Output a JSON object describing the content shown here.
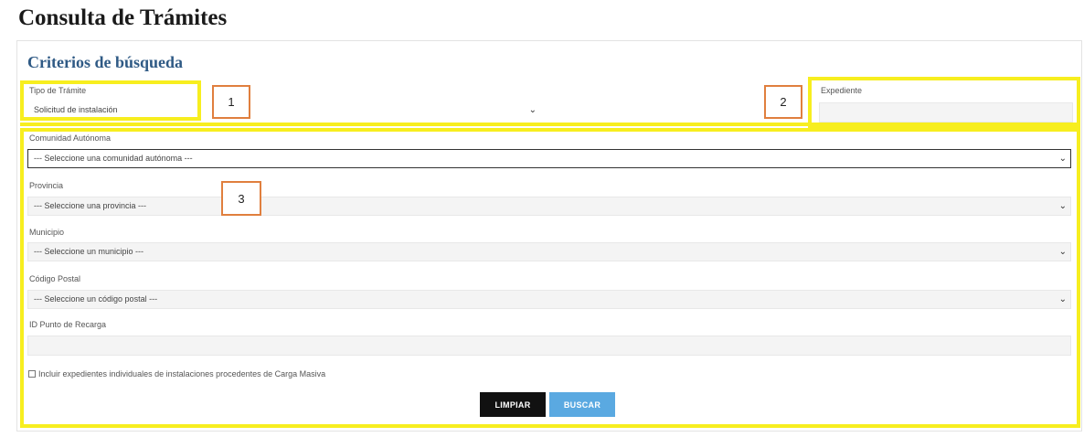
{
  "page": {
    "title": "Consulta de Trámites",
    "section_title": "Criterios de búsqueda"
  },
  "form": {
    "tipo_tramite": {
      "label": "Tipo de Trámite",
      "value": "Solicitud de instalación"
    },
    "expediente": {
      "label": "Expediente",
      "value": ""
    },
    "comunidad": {
      "label": "Comunidad Autónoma",
      "value": "--- Seleccione una comunidad autónoma ---"
    },
    "provincia": {
      "label": "Provincia",
      "value": "--- Seleccione una provincia ---"
    },
    "municipio": {
      "label": "Municipio",
      "value": "--- Seleccione un municipio ---"
    },
    "codigo_postal": {
      "label": "Código Postal",
      "value": "--- Seleccione un código postal ---"
    },
    "punto_recarga": {
      "label": "ID Punto de Recarga",
      "value": ""
    },
    "carga_masiva": {
      "label": "Incluir expedientes individuales de instalaciones procedentes de Carga Masiva",
      "checked": false
    }
  },
  "buttons": {
    "limpiar": "LIMPIAR",
    "buscar": "BUSCAR"
  },
  "callouts": [
    "1",
    "2",
    "3"
  ],
  "colors": {
    "highlight": "#f7ee1f",
    "callout_border": "#e07f3e",
    "title_blue": "#2f5a85",
    "buscar_blue": "#5aa9e1"
  }
}
